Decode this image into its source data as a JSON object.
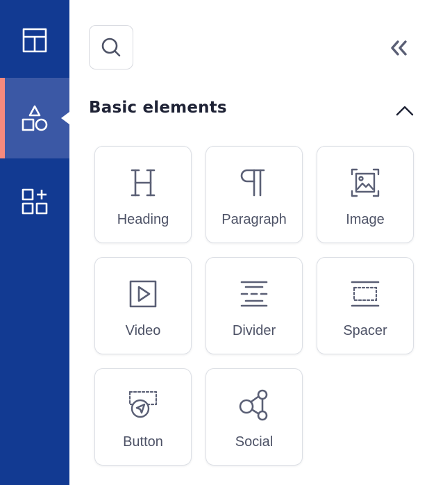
{
  "rail": {
    "items": [
      {
        "icon": "layout-icon",
        "active": false
      },
      {
        "icon": "shapes-icon",
        "active": true
      },
      {
        "icon": "add-widget-icon",
        "active": false
      }
    ],
    "colors": {
      "background": "#123a92",
      "active": "#3b58a5",
      "accent": "#f58a7e"
    }
  },
  "panel": {
    "search_icon": "search-icon",
    "collapse_icon": "double-chevron-left-icon",
    "section": {
      "title": "Basic elements",
      "toggle_icon": "chevron-up-icon",
      "tiles": [
        {
          "label": "Heading",
          "icon": "heading-icon"
        },
        {
          "label": "Paragraph",
          "icon": "paragraph-icon"
        },
        {
          "label": "Image",
          "icon": "image-icon"
        },
        {
          "label": "Video",
          "icon": "video-icon"
        },
        {
          "label": "Divider",
          "icon": "divider-icon"
        },
        {
          "label": "Spacer",
          "icon": "spacer-icon"
        },
        {
          "label": "Button",
          "icon": "button-icon"
        },
        {
          "label": "Social",
          "icon": "social-icon"
        }
      ]
    }
  }
}
